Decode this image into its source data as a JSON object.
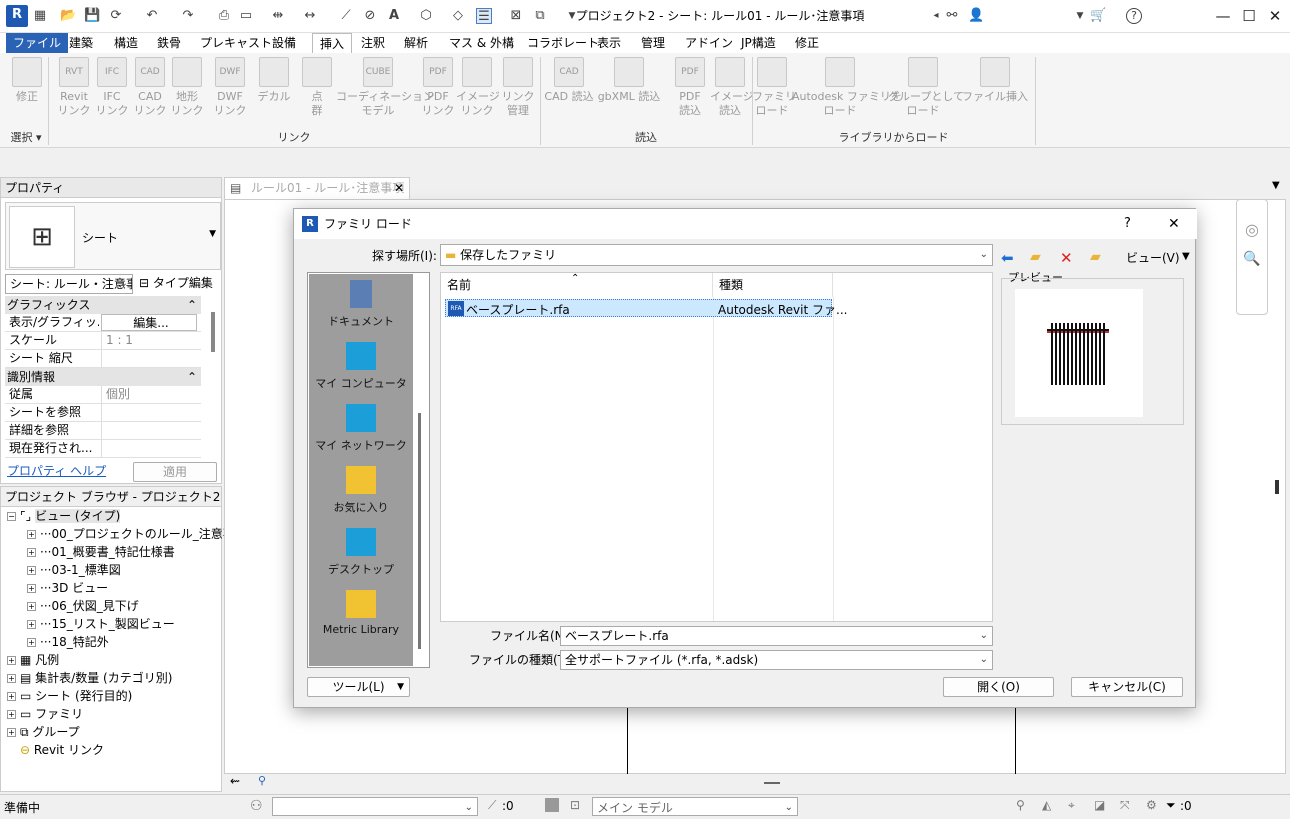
{
  "app": {
    "logo": "R",
    "title": "プロジェクト2 - シート: ルール01 - ルール･注意事項"
  },
  "tabs": [
    "ファイル",
    "建築",
    "構造",
    "鉄骨",
    "プレキャスト",
    "設備",
    "挿入",
    "注釈",
    "解析",
    "マス & 外構",
    "コラボレート",
    "表示",
    "管理",
    "アドイン",
    "JP構造",
    "修正"
  ],
  "active_tab": "挿入",
  "ribbon": {
    "buttons": [
      {
        "label": "修正",
        "icon": "cursor"
      },
      {
        "label": "Revit\nリンク",
        "icon": "RVT"
      },
      {
        "label": "IFC\nリンク",
        "icon": "IFC"
      },
      {
        "label": "CAD\nリンク",
        "icon": "CAD"
      },
      {
        "label": "地形\nリンク",
        "icon": "terrain"
      },
      {
        "label": "DWF\nリンク",
        "icon": "DWF"
      },
      {
        "label": "デカル",
        "icon": "decal"
      },
      {
        "label": "点\n群",
        "icon": "cloud"
      },
      {
        "label": "コーディネーション\nモデル",
        "icon": "cube"
      },
      {
        "label": "PDF\nリンク",
        "icon": "PDF"
      },
      {
        "label": "イメージ\nリンク",
        "icon": "image"
      },
      {
        "label": "リンク\n管理",
        "icon": "manage"
      },
      {
        "label": "CAD 読込",
        "icon": "CAD"
      },
      {
        "label": "gbXML 読込",
        "icon": "gbxml"
      },
      {
        "label": "PDF\n読込",
        "icon": "PDF"
      },
      {
        "label": "イメージ\n読込",
        "icon": "image"
      },
      {
        "label": "ファミリ\nロード",
        "icon": "family"
      },
      {
        "label": "Autodesk ファミリを\nロード",
        "icon": "autodesk"
      },
      {
        "label": "グループとして\nロード",
        "icon": "group"
      },
      {
        "label": "ファイル挿入",
        "icon": "insert"
      }
    ],
    "panels": [
      "選択 ▾",
      "リンク",
      "読込",
      "ライブラリからロード"
    ]
  },
  "properties": {
    "header": "プロパティ",
    "type_name": "シート",
    "selector": "シート: ルール・注意事I",
    "edit_type": "タイプ編集",
    "graphics_section": "グラフィックス",
    "rows_graphics": [
      {
        "k": "表示/グラフィッ...",
        "v": "編集..."
      },
      {
        "k": "スケール",
        "v": "1 : 1"
      },
      {
        "k": "シート 縮尺",
        "v": ""
      }
    ],
    "identity_section": "識別情報",
    "rows_identity": [
      {
        "k": "従属",
        "v": "個別"
      },
      {
        "k": "シートを参照",
        "v": ""
      },
      {
        "k": "詳細を参照",
        "v": ""
      },
      {
        "k": "現在発行され...",
        "v": ""
      }
    ],
    "help": "プロパティ ヘルプ",
    "apply": "適用"
  },
  "browser": {
    "header": "プロジェクト ブラウザ - プロジェクト2",
    "root": "ビュー (タイプ)",
    "views": [
      "00_プロジェクトのルール_注意事項",
      "01_概要書_特記仕様書",
      "03-1_標準図",
      "3D ビュー",
      "06_伏図_見下げ",
      "15_リスト_製図ビュー",
      "18_特記外"
    ],
    "groups": [
      "凡例",
      "集計表/数量 (カテゴリ別)",
      "シート (発行目的)",
      "ファミリ",
      "グループ",
      "Revit リンク"
    ]
  },
  "view_tab": "ルール01 - ルール･注意事項",
  "status": {
    "ready": "準備中",
    "zero1": ":0",
    "main_model": "メイン モデル",
    "zero2": ":0"
  },
  "dialog": {
    "title": "ファミリ ロード",
    "help": "?",
    "look_in_label": "探す場所(I):",
    "look_in_value": "保存したファミリ",
    "view_btn": "ビュー(V)",
    "places": [
      "ドキュメント",
      "マイ コンピュータ",
      "マイ ネットワーク",
      "お気に入り",
      "デスクトップ",
      "Metric Library"
    ],
    "columns": [
      "名前",
      "種類"
    ],
    "files": [
      {
        "name": "ベースプレート.rfa",
        "type": "Autodesk Revit ファ..."
      }
    ],
    "preview_label": "プレビュー",
    "filename_label": "ファイル名(N):",
    "filename_value": "ベースプレート.rfa",
    "filetype_label": "ファイルの種類(T):",
    "filetype_value": "全サポートファイル (*.rfa, *.adsk)",
    "tools": "ツール(L)",
    "open": "開く(O)",
    "cancel": "キャンセル(C)"
  },
  "colors": {
    "accent": "#2a63b6",
    "selection": "#cce8ff",
    "places_bg": "#9d9d9d"
  }
}
